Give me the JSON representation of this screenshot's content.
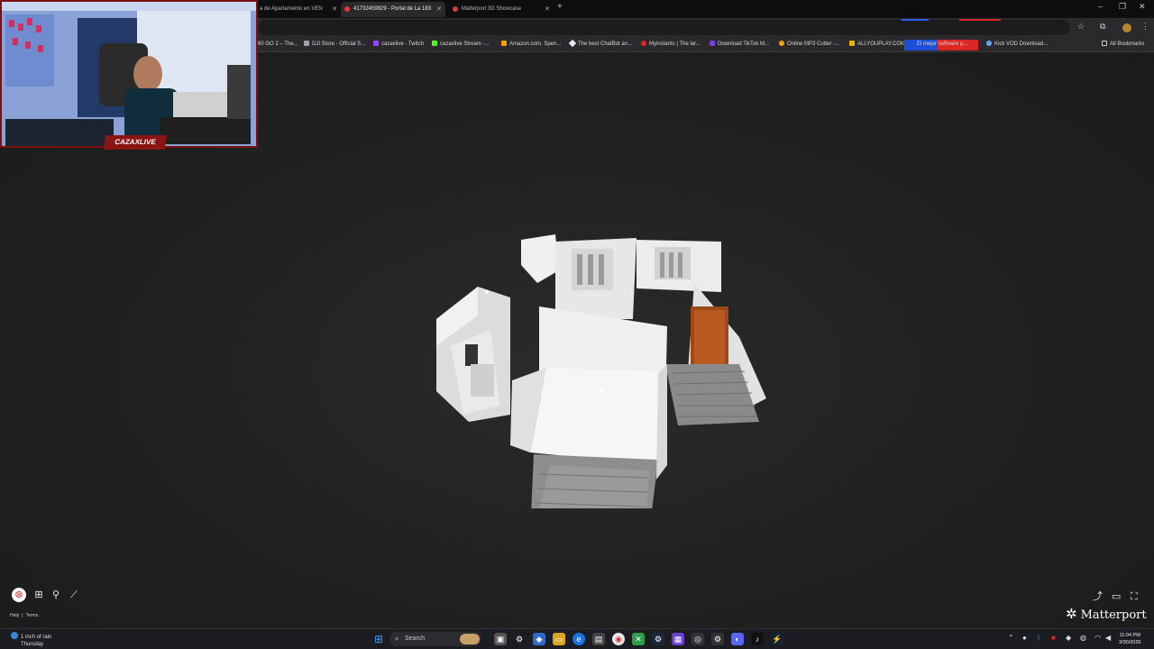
{
  "browser": {
    "tabs": [
      {
        "label": "a de Apartamento en VEN",
        "active": false
      },
      {
        "label": "41732459929 - Portal de La 183",
        "active": true
      },
      {
        "label": "Matterport 3D Showcase",
        "active": false
      }
    ],
    "bookmarks": [
      {
        "label": "60 GO 2 – The...",
        "color": "#f59e0b"
      },
      {
        "label": "DJI Store - Official S...",
        "color": "#9ca3af"
      },
      {
        "label": "cazaxlive - Twitch",
        "color": "#9146ff"
      },
      {
        "label": "cazaxlive Stream -...",
        "color": "#53fc18"
      },
      {
        "label": "Amazon.com. Spen...",
        "color": "#f59e0b"
      },
      {
        "label": "The best ChatBot an...",
        "color": "#e5e7eb"
      },
      {
        "label": "Myinstants | The lar...",
        "color": "#dc2626"
      },
      {
        "label": "Download TikTok M...",
        "color": "#7c3aed"
      },
      {
        "label": "Online MP3 Cutter -...",
        "color": "#f59e0b"
      },
      {
        "label": "ALLYOUPLAY.COM -...",
        "color": "#eab308"
      },
      {
        "label": "El mejor software p...",
        "color": "#1d4ed8"
      },
      {
        "label": "Kick VOD Download...",
        "color": "#60a5fa"
      }
    ],
    "all_bookmarks": "All Bookmarks"
  },
  "stream": {
    "streamer_name": "CAZAXLIVE"
  },
  "viewer": {
    "help": "Help",
    "separator": "|",
    "terms": "Terms",
    "brand": "Matterport"
  },
  "taskbar": {
    "weather_line1": "1 inch of rain",
    "weather_line2": "Thursday",
    "search_label": "Search",
    "time": "11:04 PM",
    "date": "3/30/2026"
  }
}
